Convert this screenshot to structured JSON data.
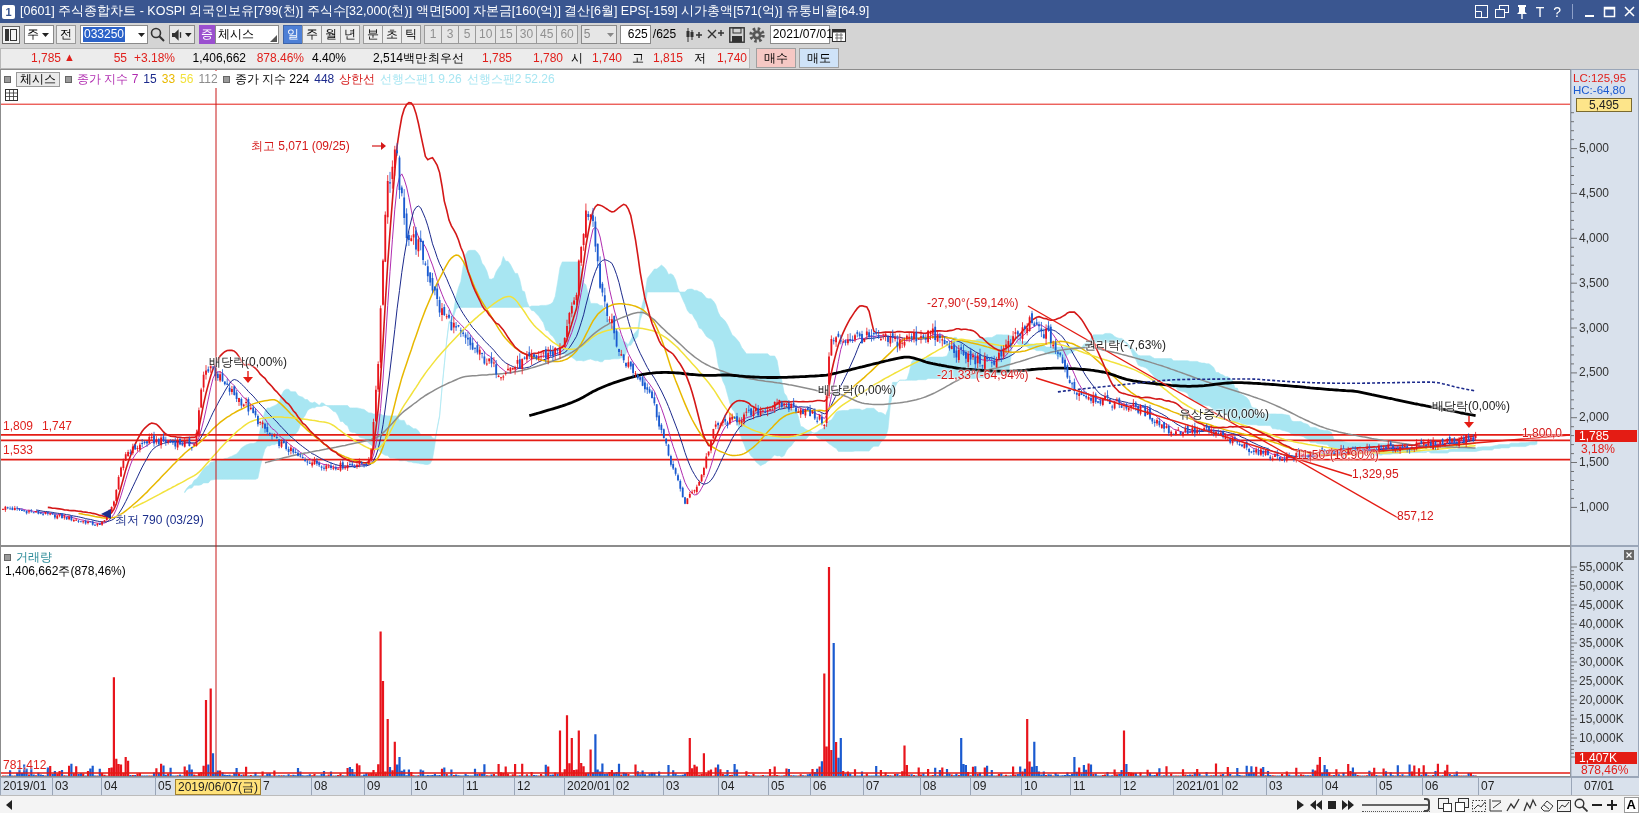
{
  "window": {
    "screen_number": "1",
    "title": "[0601] 주식종합차트 - KOSPI 외국인보유[799(천)] 주식수[32,000(천)] 액면[500] 자본금[160(억)] 결산[6월] EPS[-159] 시가총액[571(억)] 유통비율[64.9]",
    "title_buttons": [
      "T",
      "?"
    ]
  },
  "toolbar": {
    "market": "주",
    "all_button": "전",
    "stock_code": "033250",
    "market_badge": "증",
    "indicator": "체시스",
    "periods": [
      {
        "label": "일",
        "selected": true
      },
      {
        "label": "주",
        "selected": false
      },
      {
        "label": "월",
        "selected": false
      },
      {
        "label": "년",
        "selected": false
      }
    ],
    "intraday": [
      {
        "label": "분",
        "selected": false
      },
      {
        "label": "초",
        "selected": false
      },
      {
        "label": "틱",
        "selected": false
      }
    ],
    "units": [
      {
        "label": "1",
        "disabled": true
      },
      {
        "label": "3",
        "disabled": true
      },
      {
        "label": "5",
        "disabled": true
      },
      {
        "label": "10",
        "disabled": true
      },
      {
        "label": "15",
        "disabled": true
      },
      {
        "label": "30",
        "disabled": true
      },
      {
        "label": "45",
        "disabled": true
      },
      {
        "label": "60",
        "disabled": true
      }
    ],
    "interval": {
      "value": "5",
      "disabled": true
    },
    "count": "625",
    "total": "/625",
    "date": "2021/07/01"
  },
  "quote": {
    "items": [
      {
        "text": "1,785",
        "kind": "rise"
      },
      {
        "text": "▲",
        "kind": "arrow"
      },
      {
        "text": "55",
        "kind": "rise"
      },
      {
        "text": "+3.18%",
        "kind": "rise"
      },
      {
        "text": "1,406,662",
        "kind": "plain"
      },
      {
        "text": "878.46%",
        "kind": "rise"
      },
      {
        "text": "4.40%",
        "kind": "plain"
      },
      {
        "text": "2,514백만",
        "kind": "plain"
      },
      {
        "text": "최우선",
        "kind": "label"
      },
      {
        "text": "1,785",
        "kind": "rise"
      },
      {
        "text": "1,780",
        "kind": "rise"
      },
      {
        "text": "시",
        "kind": "label"
      },
      {
        "text": "1,740",
        "kind": "rise"
      },
      {
        "text": "고",
        "kind": "label"
      },
      {
        "text": "1,815",
        "kind": "rise"
      },
      {
        "text": "저",
        "kind": "label"
      },
      {
        "text": "1,740",
        "kind": "rise"
      }
    ],
    "buttons": [
      {
        "label": "매수",
        "kind": "buy"
      },
      {
        "label": "매도",
        "kind": "sell"
      }
    ]
  },
  "legend": {
    "indicator": "체시스",
    "groups": [
      {
        "items": [
          {
            "text": "종가 지수 7",
            "color": "#b02cb0"
          },
          {
            "text": "15",
            "color": "#1c2a8c"
          },
          {
            "text": "33",
            "color": "#e8b800"
          },
          {
            "text": "56",
            "color": "#f2e23c"
          },
          {
            "text": "112",
            "color": "#8c8c8c"
          }
        ]
      },
      {
        "items": [
          {
            "text": "종가 지수 224",
            "color": "#000000"
          },
          {
            "text": "448",
            "color": "#1c2a8c"
          },
          {
            "text": "상한선",
            "color": "#d41818"
          },
          {
            "text": "선행스팬1 9.26",
            "color": "#a8e6f2"
          },
          {
            "text": "선행스팬2 52.26",
            "color": "#a8e6f2"
          }
        ]
      }
    ]
  },
  "price_chart": {
    "annotations": [
      {
        "text": "최고 5,071 (09/25)",
        "kind": "peak"
      },
      {
        "text": "-27,90°(-59,14%)",
        "kind": "trend"
      },
      {
        "text": "권리락(-7,63%)",
        "kind": "event"
      },
      {
        "text": "배당락(0,00%)",
        "kind": "event"
      },
      {
        "text": "-21,33°(-64,94%)",
        "kind": "trend"
      },
      {
        "text": "배당락(0,00%)",
        "kind": "event"
      },
      {
        "text": "배당락(0,00%)",
        "kind": "event"
      },
      {
        "text": "유상증자(0,00%)",
        "kind": "event"
      },
      {
        "text": "1,800,0",
        "kind": "trend"
      },
      {
        "text": "11,50°(16,90%)",
        "kind": "trend"
      },
      {
        "text": "1,329,95",
        "kind": "trend"
      },
      {
        "text": "857,12",
        "kind": "trend"
      },
      {
        "text": "최저 790 (03/29)",
        "kind": "trough"
      }
    ],
    "level_labels": [
      "1,809",
      "1,747",
      "1,533"
    ]
  },
  "price_axis": {
    "lc": "LC:125,95",
    "hc": "HC:-64,80",
    "high_marker": "5,495",
    "ticks": [
      "5,000",
      "4,500",
      "4,000",
      "3,500",
      "3,000",
      "2,500",
      "2,000",
      "1,500",
      "1,000"
    ],
    "last_marker": "1,785",
    "change": "3,18%"
  },
  "volume_chart": {
    "title": "거래량",
    "reading": "1,406,662주(878,46%)",
    "average_label": "781,412"
  },
  "volume_axis": {
    "ticks": [
      "55,000K",
      "50,000K",
      "45,000K",
      "40,000K",
      "35,000K",
      "30,000K",
      "25,000K",
      "20,000K",
      "15,000K",
      "10,000K"
    ],
    "last_marker": "1,407K",
    "change": "878,46%"
  },
  "x_axis": {
    "labels": [
      "2019/01",
      "03",
      "04",
      "05",
      "7",
      "08",
      "09",
      "10",
      "11",
      "12",
      "2020/01",
      "02",
      "03",
      "04",
      "05",
      "06",
      "07",
      "08",
      "09",
      "10",
      "11",
      "12",
      "2021/01",
      "02",
      "03",
      "04",
      "05",
      "06",
      "07"
    ],
    "cursor_label": "2019/06/07(금)",
    "end_label": "07/01"
  },
  "playback": {
    "speed_slider": {
      "level": 1
    },
    "font_button": "A"
  }
}
